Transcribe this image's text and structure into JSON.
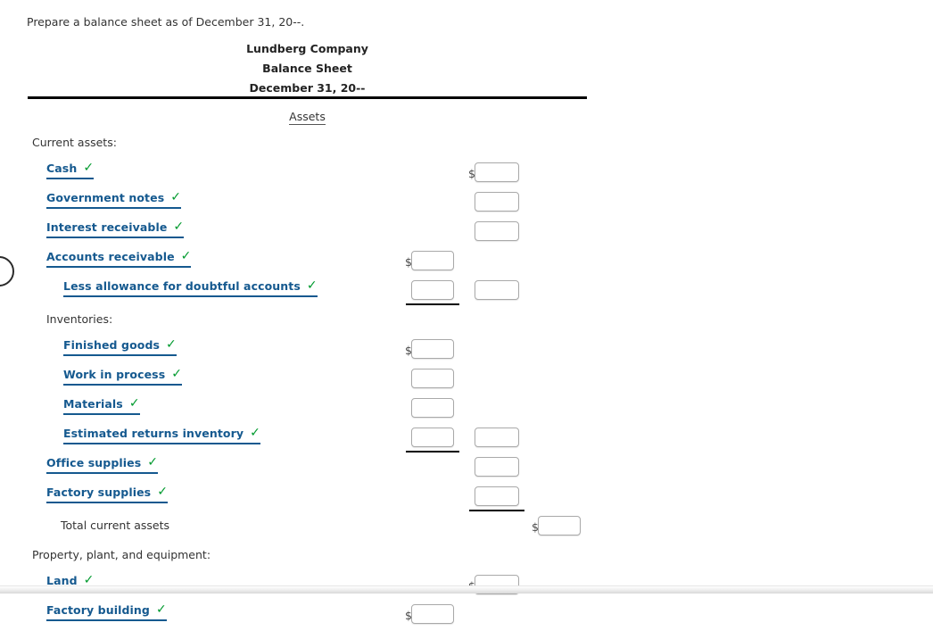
{
  "prompt": "Prepare a balance sheet as of December 31, 20--.",
  "statement": {
    "company": "Lundberg Company",
    "title": "Balance Sheet",
    "date": "December 31, 20--",
    "section_title": "Assets"
  },
  "icons": {
    "check": "✓",
    "dollar": "$"
  },
  "colors": {
    "link": "#15598f",
    "check": "#009a2e",
    "rule": "#000000",
    "input_border": "#a9a9a9"
  },
  "rows": [
    {
      "label": "Current assets:",
      "kind": "plain",
      "indent": 36
    },
    {
      "label": "Cash",
      "kind": "link",
      "indent": 52,
      "value": "",
      "placeholder": ""
    },
    {
      "label": "Government notes",
      "kind": "link",
      "indent": 52,
      "value": "",
      "placeholder": ""
    },
    {
      "label": "Interest receivable",
      "kind": "link",
      "indent": 52,
      "value": "",
      "placeholder": ""
    },
    {
      "label": "Accounts receivable",
      "kind": "link",
      "indent": 52,
      "value": "",
      "placeholder": ""
    },
    {
      "label": "Less allowance for doubtful accounts",
      "kind": "link",
      "indent": 71,
      "value": "",
      "placeholder": ""
    },
    {
      "label": "Inventories:",
      "kind": "plain",
      "indent": 52
    },
    {
      "label": "Finished goods",
      "kind": "link",
      "indent": 71,
      "value": "",
      "placeholder": ""
    },
    {
      "label": "Work in process",
      "kind": "link",
      "indent": 71,
      "value": "",
      "placeholder": ""
    },
    {
      "label": "Materials",
      "kind": "link",
      "indent": 71,
      "value": "",
      "placeholder": ""
    },
    {
      "label": "Estimated returns inventory",
      "kind": "link",
      "indent": 71,
      "value": "",
      "placeholder": ""
    },
    {
      "label": "Office supplies",
      "kind": "link",
      "indent": 52,
      "value": "",
      "placeholder": ""
    },
    {
      "label": "Factory supplies",
      "kind": "link",
      "indent": 52,
      "value": "",
      "placeholder": ""
    },
    {
      "label": "Total current assets",
      "kind": "plain",
      "indent": 68
    },
    {
      "label": "Property, plant, and equipment:",
      "kind": "plain",
      "indent": 36
    },
    {
      "label": "Land",
      "kind": "link",
      "indent": 52,
      "value": "",
      "placeholder": ""
    },
    {
      "label": "Factory building",
      "kind": "link",
      "indent": 52,
      "value": "",
      "placeholder": ""
    }
  ]
}
